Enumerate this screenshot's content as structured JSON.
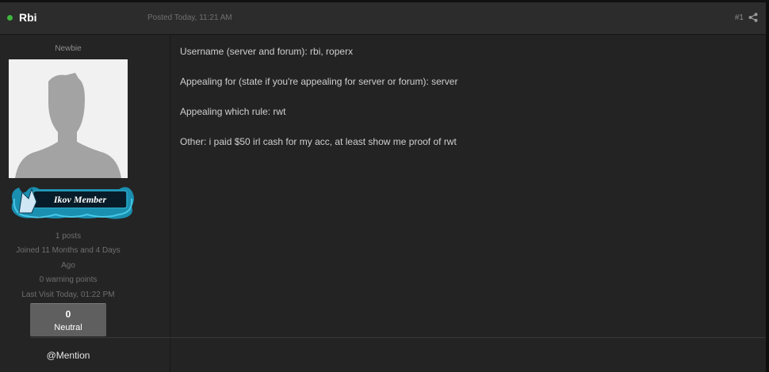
{
  "post": {
    "author": "Rbi",
    "posted": "Posted Today, 11:21 AM",
    "number": "#1",
    "status_color": "#3fb63f"
  },
  "sidebar": {
    "rank": "Newbie",
    "badge_text": "Ikov Member",
    "stats": {
      "posts": "1 posts",
      "joined_line1": "Joined 11 Months and 4 Days",
      "joined_line2": "Ago",
      "warnings": "0 warning points",
      "last_visit": "Last Visit Today, 01:22 PM"
    },
    "reputation": {
      "count": "0",
      "label": "Neutral"
    },
    "mention": "@Mention"
  },
  "content": {
    "lines": [
      "Username (server and forum): rbi, roperx",
      "Appealing for (state if you're appealing for server or forum): server",
      "Appealing which rule: rwt",
      "Other: i paid $50 irl cash for my acc, at least show me proof of rwt"
    ]
  },
  "icons": {
    "status": "online-status-icon",
    "share": "share-icon",
    "avatar": "default-avatar-silhouette",
    "badge": "wolf-emblem-icon"
  }
}
